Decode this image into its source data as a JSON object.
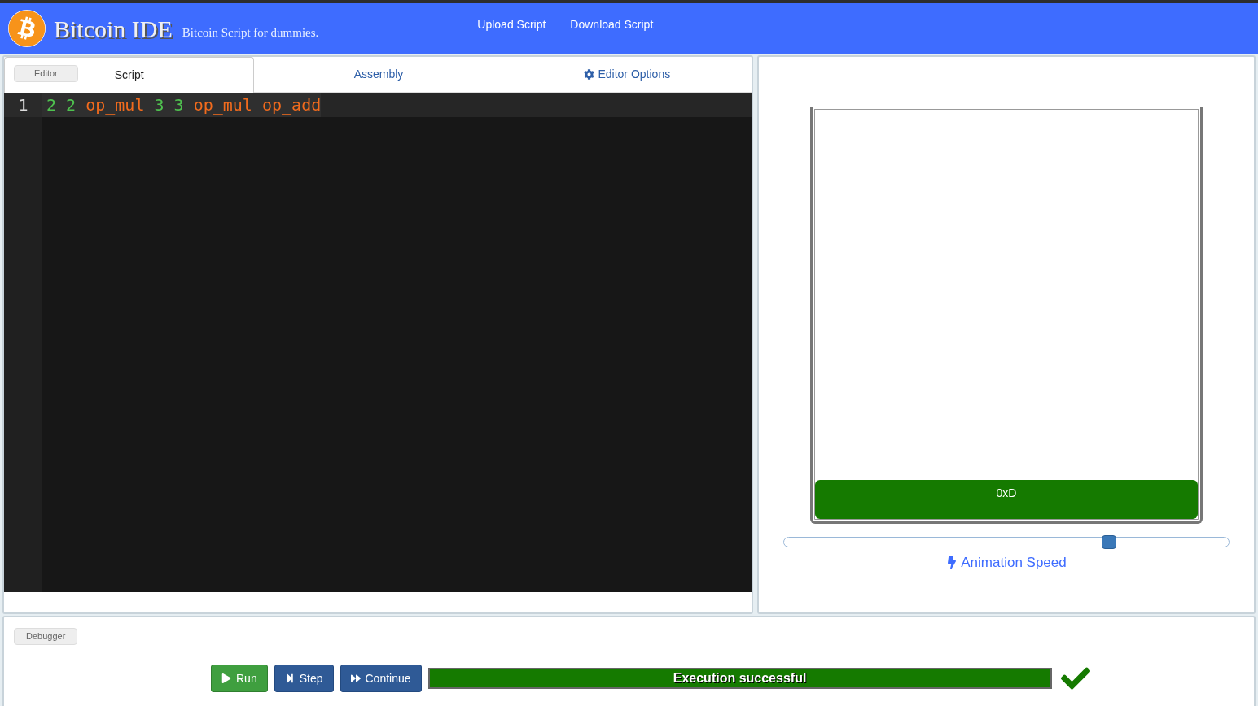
{
  "header": {
    "title": "Bitcoin IDE",
    "tagline": "Bitcoin Script for dummies.",
    "links": [
      "Upload Script",
      "Download Script"
    ]
  },
  "editor": {
    "badge": "Editor",
    "tabs": [
      {
        "label": "Script",
        "selected": true,
        "kind": "plain"
      },
      {
        "label": "Assembly",
        "selected": false,
        "kind": "plain"
      },
      {
        "label": "Editor Options",
        "selected": false,
        "kind": "options"
      }
    ],
    "lines": [
      {
        "number": "1",
        "tokens": [
          {
            "text": "2",
            "kind": "number"
          },
          {
            "text": "2",
            "kind": "number"
          },
          {
            "text": "op_mul",
            "kind": "opcode"
          },
          {
            "text": "3",
            "kind": "number"
          },
          {
            "text": "3",
            "kind": "number"
          },
          {
            "text": "op_mul",
            "kind": "opcode"
          },
          {
            "text": "op_add",
            "kind": "opcode"
          }
        ]
      }
    ]
  },
  "stack": {
    "items": [
      "0xD"
    ],
    "speed": {
      "level": 0.73,
      "label": "Animation Speed"
    }
  },
  "debugger": {
    "badge": "Debugger",
    "buttons": [
      {
        "label": "Run",
        "kind": "run"
      },
      {
        "label": "Step",
        "kind": "step"
      },
      {
        "label": "Continue",
        "kind": "continue"
      }
    ],
    "status": {
      "text": "Execution successful",
      "kind": "success"
    }
  }
}
